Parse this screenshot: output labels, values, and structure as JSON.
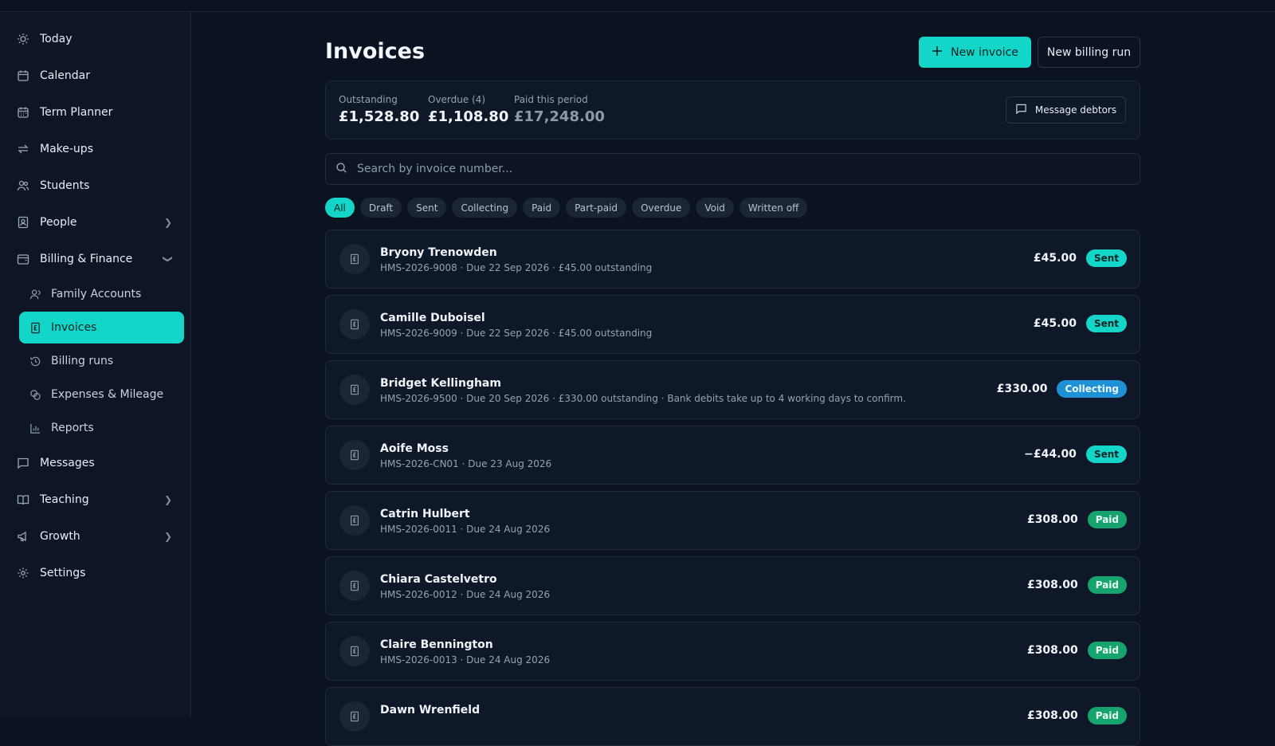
{
  "sidebar": {
    "items": [
      {
        "label": "Today",
        "icon": "sun-icon"
      },
      {
        "label": "Calendar",
        "icon": "calendar-icon"
      },
      {
        "label": "Term Planner",
        "icon": "calendar-grid-icon"
      },
      {
        "label": "Make-ups",
        "icon": "repeat-icon"
      },
      {
        "label": "Students",
        "icon": "users-icon"
      },
      {
        "label": "People",
        "icon": "contact-icon"
      },
      {
        "label": "Billing & Finance",
        "icon": "wallet-icon"
      },
      {
        "label": "Messages",
        "icon": "message-icon"
      },
      {
        "label": "Teaching",
        "icon": "book-icon"
      },
      {
        "label": "Growth",
        "icon": "megaphone-icon"
      },
      {
        "label": "Settings",
        "icon": "gear-icon"
      }
    ],
    "billing_sub": [
      {
        "label": "Family Accounts",
        "icon": "user-icon"
      },
      {
        "label": "Invoices",
        "icon": "invoice-icon",
        "active": true
      },
      {
        "label": "Billing runs",
        "icon": "history-icon"
      },
      {
        "label": "Expenses & Mileage",
        "icon": "coins-icon"
      },
      {
        "label": "Reports",
        "icon": "bar-chart-icon"
      }
    ]
  },
  "header": {
    "title": "Invoices",
    "new_invoice_label": "New invoice",
    "new_billing_run_label": "New billing run"
  },
  "summary": {
    "outstanding_label": "Outstanding",
    "outstanding_value": "£1,528.80",
    "overdue_label": "Overdue (4)",
    "overdue_value": "£1,108.80",
    "paid_label": "Paid this period",
    "paid_value": "£17,248.00",
    "message_debtors_label": "Message debtors"
  },
  "search": {
    "placeholder": "Search by invoice number..."
  },
  "filters": [
    "All",
    "Draft",
    "Sent",
    "Collecting",
    "Paid",
    "Part-paid",
    "Overdue",
    "Void",
    "Written off"
  ],
  "active_filter": "All",
  "invoices": [
    {
      "name": "Bryony Trenowden",
      "meta": "HMS-2026-9008 · Due 22 Sep 2026 · £45.00 outstanding",
      "amount": "£45.00",
      "status": "Sent"
    },
    {
      "name": "Camille Duboisel",
      "meta": "HMS-2026-9009 · Due 22 Sep 2026 · £45.00 outstanding",
      "amount": "£45.00",
      "status": "Sent"
    },
    {
      "name": "Bridget Kellingham",
      "meta": "HMS-2026-9500 · Due 20 Sep 2026 · £330.00 outstanding · Bank debits take up to 4 working days to confirm.",
      "amount": "£330.00",
      "status": "Collecting"
    },
    {
      "name": "Aoife Moss",
      "meta": "HMS-2026-CN01 · Due 23 Aug 2026",
      "amount": "−£44.00",
      "status": "Sent"
    },
    {
      "name": "Catrin Hulbert",
      "meta": "HMS-2026-0011 · Due 24 Aug 2026",
      "amount": "£308.00",
      "status": "Paid"
    },
    {
      "name": "Chiara Castelvetro",
      "meta": "HMS-2026-0012 · Due 24 Aug 2026",
      "amount": "£308.00",
      "status": "Paid"
    },
    {
      "name": "Claire Bennington",
      "meta": "HMS-2026-0013 · Due 24 Aug 2026",
      "amount": "£308.00",
      "status": "Paid"
    },
    {
      "name": "Dawn Wrenfield",
      "meta": "",
      "amount": "£308.00",
      "status": "Paid"
    }
  ],
  "colors": {
    "accent": "#14d6c8",
    "collecting": "#1e90d6",
    "paid": "#17a36d"
  }
}
